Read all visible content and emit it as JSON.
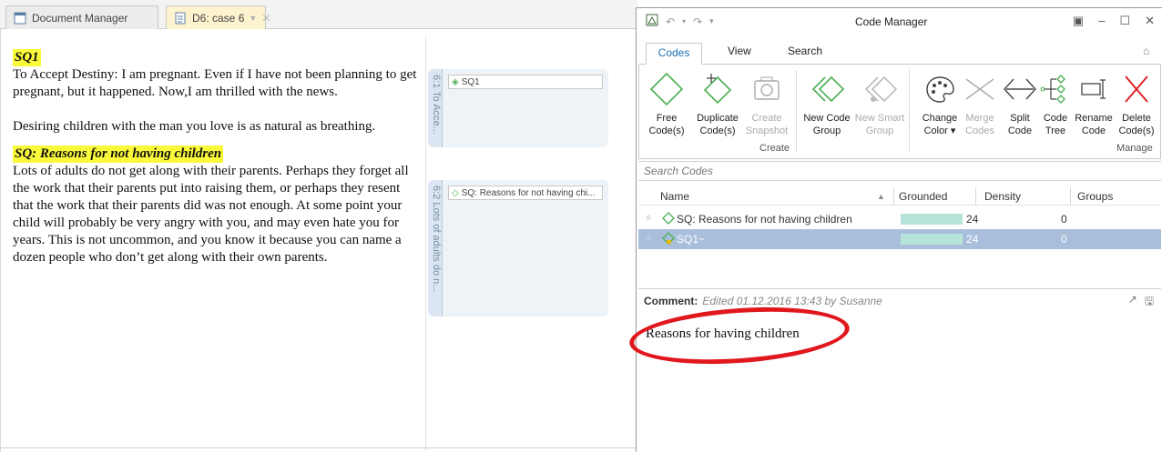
{
  "tabs": {
    "document_manager": "Document Manager",
    "current_doc": "D6: case 6"
  },
  "document": {
    "heading1": "SQ1",
    "para1": "To Accept Destiny:  I am pregnant. Even if I have not  been planning to get pregnant, but it happened. Now,I am thrilled with the news.",
    "para2": "Desiring children with the man you love is as natural as breathing.",
    "heading2": "SQ: Reasons for not having children",
    "para3": "Lots of adults do not get along with their parents. Perhaps they forget all the work that their parents put into raising them, or perhaps they resent that the work that their parents did was not enough. At some point your child will probably be very angry with you, and may even hate you for years. This is not uncommon, and you know it because you can name a dozen people who don’t get along with their own parents.",
    "seg1_label": "6:1 To Acce...",
    "seg1_code": "SQ1",
    "seg2_label": "6:2 Lots of adults do n...",
    "seg2_code": "SQ: Reasons for not having chi..."
  },
  "code_manager": {
    "title": "Code Manager",
    "ribbon_tabs": [
      "Codes",
      "View",
      "Search"
    ],
    "buttons": {
      "free": "Free Code(s)",
      "duplicate": "Duplicate Code(s)",
      "snapshot": "Create Snapshot",
      "new_group": "New Code Group",
      "new_smart": "New Smart Group",
      "change_color": "Change Color ▾",
      "merge": "Merge Codes",
      "split": "Split Code",
      "code_tree": "Code Tree",
      "rename": "Rename Code",
      "delete": "Delete Code(s)"
    },
    "group_create": "Create",
    "group_manage": "Manage",
    "search_placeholder": "Search Codes",
    "columns": {
      "name": "Name",
      "grounded": "Grounded",
      "density": "Density",
      "groups": "Groups"
    },
    "rows": [
      {
        "name": "SQ: Reasons for not having children",
        "grounded": "24",
        "density": "0"
      },
      {
        "name": "SQ1~",
        "grounded": "24",
        "density": "0"
      }
    ],
    "comment_label": "Comment:",
    "comment_meta": "Edited 01.12.2016 13:43 by Susanne",
    "comment_text": "Reasons for having children"
  },
  "colors": {
    "accent": "#1e72b6",
    "code_green": "#4caf50",
    "annotation_red": "#e0181e",
    "highlight": "#fafa3a"
  }
}
